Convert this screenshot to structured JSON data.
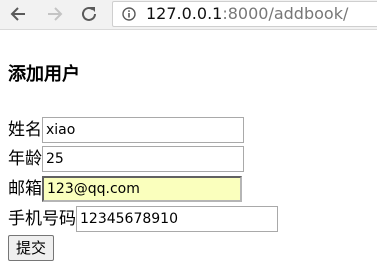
{
  "browser": {
    "url_host": "127.0.0.1",
    "url_rest": ":8000/addbook/"
  },
  "page": {
    "title": "添加用户"
  },
  "form": {
    "name_label": "姓名",
    "name_value": "xiao",
    "age_label": "年龄",
    "age_value": "25",
    "email_label": "邮箱",
    "email_value": "123@qq.com",
    "phone_label": "手机号码",
    "phone_value": "12345678910",
    "submit_label": "提交"
  },
  "colors": {
    "autofill_bg": "#faffbd"
  }
}
